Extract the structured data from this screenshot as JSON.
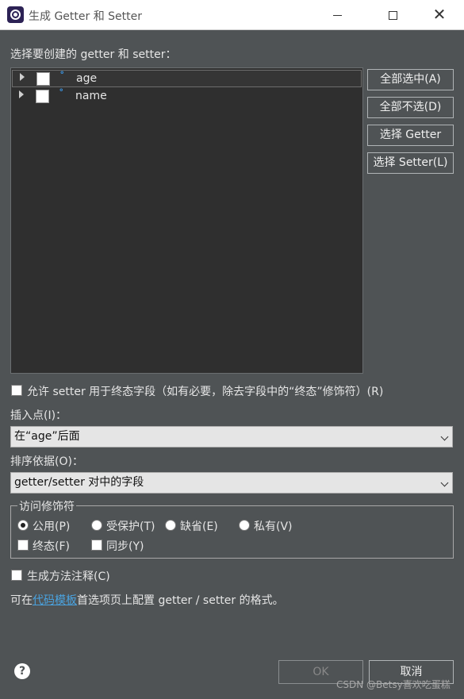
{
  "window": {
    "title": "生成 Getter 和 Setter"
  },
  "prompt_label": "选择要创建的 getter 和 setter：",
  "fields": [
    {
      "name": "age",
      "checked": false,
      "selected": true
    },
    {
      "name": "name",
      "checked": false,
      "selected": false
    }
  ],
  "side_buttons": {
    "select_all": "全部选中(A)",
    "deselect_all": "全部不选(D)",
    "select_getter": "选择 Getter",
    "select_setter": "选择 Setter(L)"
  },
  "allow_setter_final": {
    "label": "允许 setter 用于终态字段（如有必要，除去字段中的“终态”修饰符）(R)",
    "checked": false
  },
  "insertion_point": {
    "label": "插入点(I)：",
    "value": "在“age”后面"
  },
  "sort_by": {
    "label": "排序依据(O)：",
    "value": "getter/setter 对中的字段"
  },
  "access_modifier": {
    "title": "访问修饰符",
    "radios": [
      {
        "label": "公用(P)",
        "selected": true
      },
      {
        "label": "受保护(T)",
        "selected": false
      },
      {
        "label": "缺省(E)",
        "selected": false
      },
      {
        "label": "私有(V)",
        "selected": false
      }
    ],
    "final_label": "终态(F)",
    "sync_label": "同步(Y)"
  },
  "generate_comments": {
    "label": "生成方法注释(C)",
    "checked": false
  },
  "config_note": {
    "prefix": "可在",
    "link": "代码模板",
    "suffix": "首选项页上配置 getter / setter 的格式。"
  },
  "footer": {
    "help_icon": "question-mark-icon",
    "ok_label": "OK",
    "cancel_label": "取消",
    "watermark": "CSDN @Betsy喜欢吃蛋糕"
  },
  "colors": {
    "background": "#4f5355",
    "tree_background": "#2f2f2f",
    "link": "#4aa3e0",
    "field_icon": "#3a8fd8"
  }
}
